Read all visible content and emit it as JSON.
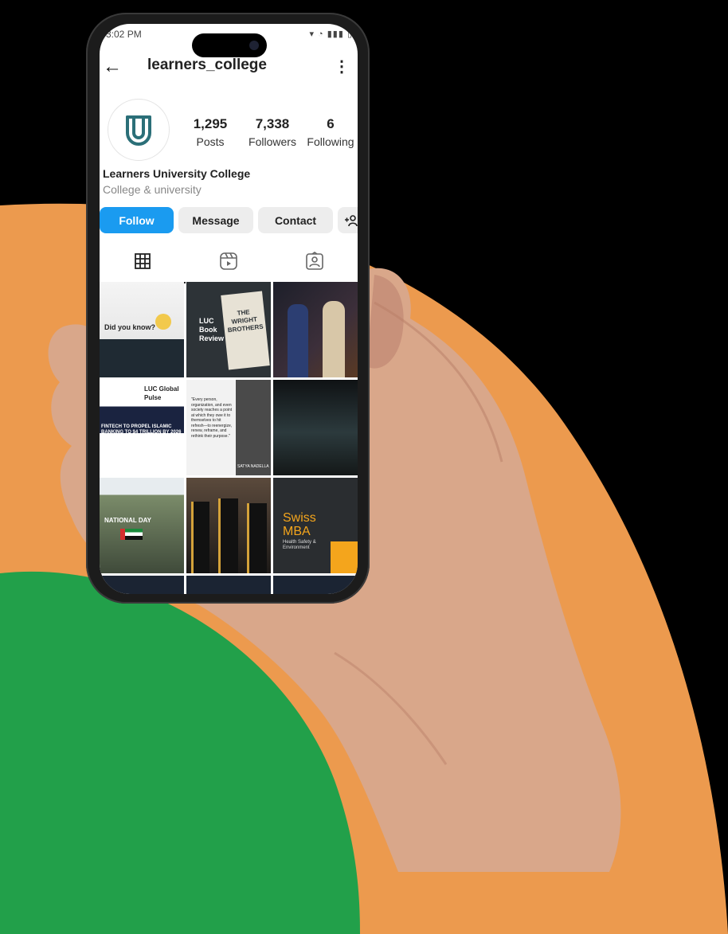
{
  "status_bar": {
    "time": "3:02 PM"
  },
  "profile": {
    "username": "learners_college",
    "posts_count": "1,295",
    "posts_label": "Posts",
    "followers_count": "7,338",
    "followers_label": "Followers",
    "following_count": "6",
    "following_label": "Following",
    "display_name": "Learners University College",
    "category": "College & university"
  },
  "actions": {
    "follow_label": "Follow",
    "message_label": "Message",
    "contact_label": "Contact"
  },
  "tabs": [
    {
      "icon": "grid-icon",
      "active": true
    },
    {
      "icon": "reels-icon",
      "active": false
    },
    {
      "icon": "tagged-icon",
      "active": false
    }
  ],
  "posts": {
    "tile_1_caption": "Did you know?",
    "tile_2_title": "LUC Book Review",
    "tile_2_book": "THE WRIGHT BROTHERS",
    "tile_4_brand": "LUC Global Pulse",
    "tile_4_headline": "FINTECH TO PROPEL ISLAMIC BANKING TO $4 TRILLION BY 2026",
    "tile_5_quote": "\"Every person, organization, and even society reaches a point at which they owe it to themselves to hit refresh—to reenergize, renew, reframe, and rethink their purpose.\"",
    "tile_5_author": "SATYA NADELLA",
    "tile_7_text": "NATIONAL DAY",
    "tile_9_title": "Swiss MBA",
    "tile_9_sub": "Health Safety & Environment"
  },
  "colors": {
    "follow_blue": "#1a9bf0",
    "brand_teal": "#2b6f78",
    "background_orange": "#ec9a4e",
    "background_green": "#22a04a"
  }
}
